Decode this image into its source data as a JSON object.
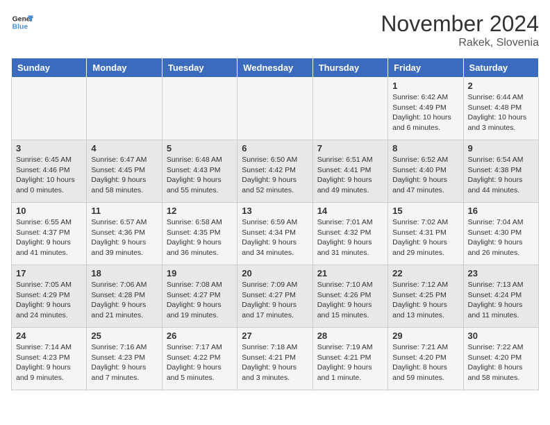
{
  "header": {
    "logo_line1": "General",
    "logo_line2": "Blue",
    "month": "November 2024",
    "location": "Rakek, Slovenia"
  },
  "days_of_week": [
    "Sunday",
    "Monday",
    "Tuesday",
    "Wednesday",
    "Thursday",
    "Friday",
    "Saturday"
  ],
  "weeks": [
    [
      {
        "day": "",
        "info": ""
      },
      {
        "day": "",
        "info": ""
      },
      {
        "day": "",
        "info": ""
      },
      {
        "day": "",
        "info": ""
      },
      {
        "day": "",
        "info": ""
      },
      {
        "day": "1",
        "info": "Sunrise: 6:42 AM\nSunset: 4:49 PM\nDaylight: 10 hours\nand 6 minutes."
      },
      {
        "day": "2",
        "info": "Sunrise: 6:44 AM\nSunset: 4:48 PM\nDaylight: 10 hours\nand 3 minutes."
      }
    ],
    [
      {
        "day": "3",
        "info": "Sunrise: 6:45 AM\nSunset: 4:46 PM\nDaylight: 10 hours\nand 0 minutes."
      },
      {
        "day": "4",
        "info": "Sunrise: 6:47 AM\nSunset: 4:45 PM\nDaylight: 9 hours\nand 58 minutes."
      },
      {
        "day": "5",
        "info": "Sunrise: 6:48 AM\nSunset: 4:43 PM\nDaylight: 9 hours\nand 55 minutes."
      },
      {
        "day": "6",
        "info": "Sunrise: 6:50 AM\nSunset: 4:42 PM\nDaylight: 9 hours\nand 52 minutes."
      },
      {
        "day": "7",
        "info": "Sunrise: 6:51 AM\nSunset: 4:41 PM\nDaylight: 9 hours\nand 49 minutes."
      },
      {
        "day": "8",
        "info": "Sunrise: 6:52 AM\nSunset: 4:40 PM\nDaylight: 9 hours\nand 47 minutes."
      },
      {
        "day": "9",
        "info": "Sunrise: 6:54 AM\nSunset: 4:38 PM\nDaylight: 9 hours\nand 44 minutes."
      }
    ],
    [
      {
        "day": "10",
        "info": "Sunrise: 6:55 AM\nSunset: 4:37 PM\nDaylight: 9 hours\nand 41 minutes."
      },
      {
        "day": "11",
        "info": "Sunrise: 6:57 AM\nSunset: 4:36 PM\nDaylight: 9 hours\nand 39 minutes."
      },
      {
        "day": "12",
        "info": "Sunrise: 6:58 AM\nSunset: 4:35 PM\nDaylight: 9 hours\nand 36 minutes."
      },
      {
        "day": "13",
        "info": "Sunrise: 6:59 AM\nSunset: 4:34 PM\nDaylight: 9 hours\nand 34 minutes."
      },
      {
        "day": "14",
        "info": "Sunrise: 7:01 AM\nSunset: 4:32 PM\nDaylight: 9 hours\nand 31 minutes."
      },
      {
        "day": "15",
        "info": "Sunrise: 7:02 AM\nSunset: 4:31 PM\nDaylight: 9 hours\nand 29 minutes."
      },
      {
        "day": "16",
        "info": "Sunrise: 7:04 AM\nSunset: 4:30 PM\nDaylight: 9 hours\nand 26 minutes."
      }
    ],
    [
      {
        "day": "17",
        "info": "Sunrise: 7:05 AM\nSunset: 4:29 PM\nDaylight: 9 hours\nand 24 minutes."
      },
      {
        "day": "18",
        "info": "Sunrise: 7:06 AM\nSunset: 4:28 PM\nDaylight: 9 hours\nand 21 minutes."
      },
      {
        "day": "19",
        "info": "Sunrise: 7:08 AM\nSunset: 4:27 PM\nDaylight: 9 hours\nand 19 minutes."
      },
      {
        "day": "20",
        "info": "Sunrise: 7:09 AM\nSunset: 4:27 PM\nDaylight: 9 hours\nand 17 minutes."
      },
      {
        "day": "21",
        "info": "Sunrise: 7:10 AM\nSunset: 4:26 PM\nDaylight: 9 hours\nand 15 minutes."
      },
      {
        "day": "22",
        "info": "Sunrise: 7:12 AM\nSunset: 4:25 PM\nDaylight: 9 hours\nand 13 minutes."
      },
      {
        "day": "23",
        "info": "Sunrise: 7:13 AM\nSunset: 4:24 PM\nDaylight: 9 hours\nand 11 minutes."
      }
    ],
    [
      {
        "day": "24",
        "info": "Sunrise: 7:14 AM\nSunset: 4:23 PM\nDaylight: 9 hours\nand 9 minutes."
      },
      {
        "day": "25",
        "info": "Sunrise: 7:16 AM\nSunset: 4:23 PM\nDaylight: 9 hours\nand 7 minutes."
      },
      {
        "day": "26",
        "info": "Sunrise: 7:17 AM\nSunset: 4:22 PM\nDaylight: 9 hours\nand 5 minutes."
      },
      {
        "day": "27",
        "info": "Sunrise: 7:18 AM\nSunset: 4:21 PM\nDaylight: 9 hours\nand 3 minutes."
      },
      {
        "day": "28",
        "info": "Sunrise: 7:19 AM\nSunset: 4:21 PM\nDaylight: 9 hours\nand 1 minute."
      },
      {
        "day": "29",
        "info": "Sunrise: 7:21 AM\nSunset: 4:20 PM\nDaylight: 8 hours\nand 59 minutes."
      },
      {
        "day": "30",
        "info": "Sunrise: 7:22 AM\nSunset: 4:20 PM\nDaylight: 8 hours\nand 58 minutes."
      }
    ]
  ]
}
